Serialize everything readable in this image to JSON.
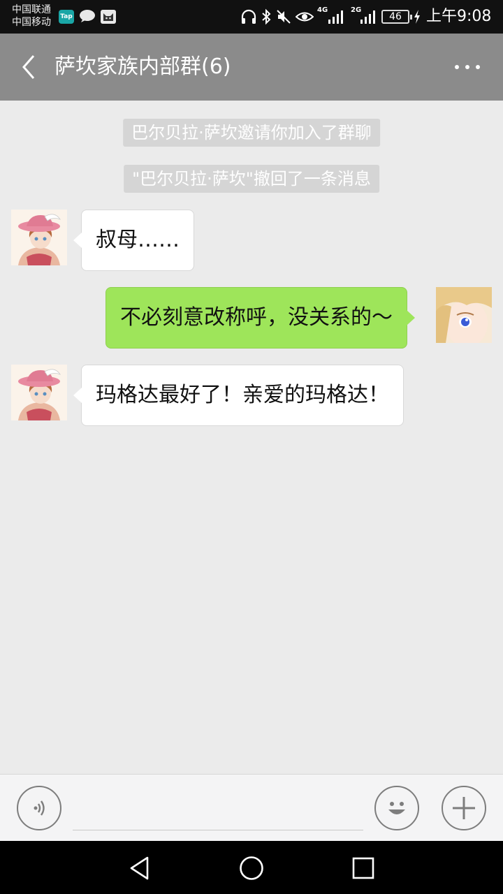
{
  "status_bar": {
    "carrier_1": "中国联通",
    "carrier_2": "中国移动",
    "tap_badge": "Tap",
    "network_1": "4G",
    "network_2": "2G",
    "battery": "46",
    "time": "上午9:08",
    "icons": [
      "tap-icon",
      "wechat-icon",
      "cat-icon",
      "headphones-icon",
      "bluetooth-icon",
      "mute-icon",
      "eye-icon",
      "signal-icon",
      "signal-icon",
      "battery-icon",
      "charging-icon"
    ]
  },
  "header": {
    "title": "萨坎家族内部群(6)",
    "icons": [
      "back-arrow-icon",
      "more-icon"
    ]
  },
  "notices": [
    "巴尔贝拉·萨坎邀请你加入了群聊",
    "\"巴尔贝拉·萨坎\"撤回了一条消息"
  ],
  "messages": [
    {
      "side": "in",
      "text": "叔母……"
    },
    {
      "side": "out",
      "text": "不必刻意改称呼，没关系的～"
    },
    {
      "side": "in",
      "text": "玛格达最好了！亲爱的玛格达！"
    }
  ],
  "input_bar": {
    "icons": [
      "voice-icon",
      "emoji-icon",
      "plus-icon"
    ]
  },
  "nav_bar": {
    "icons": [
      "back-triangle-icon",
      "home-circle-icon",
      "recents-square-icon"
    ]
  },
  "colors": {
    "header_bg": "#8b8b8b",
    "chat_bg": "#ebebeb",
    "bubble_out": "#9ee55a",
    "bubble_in": "#ffffff"
  }
}
